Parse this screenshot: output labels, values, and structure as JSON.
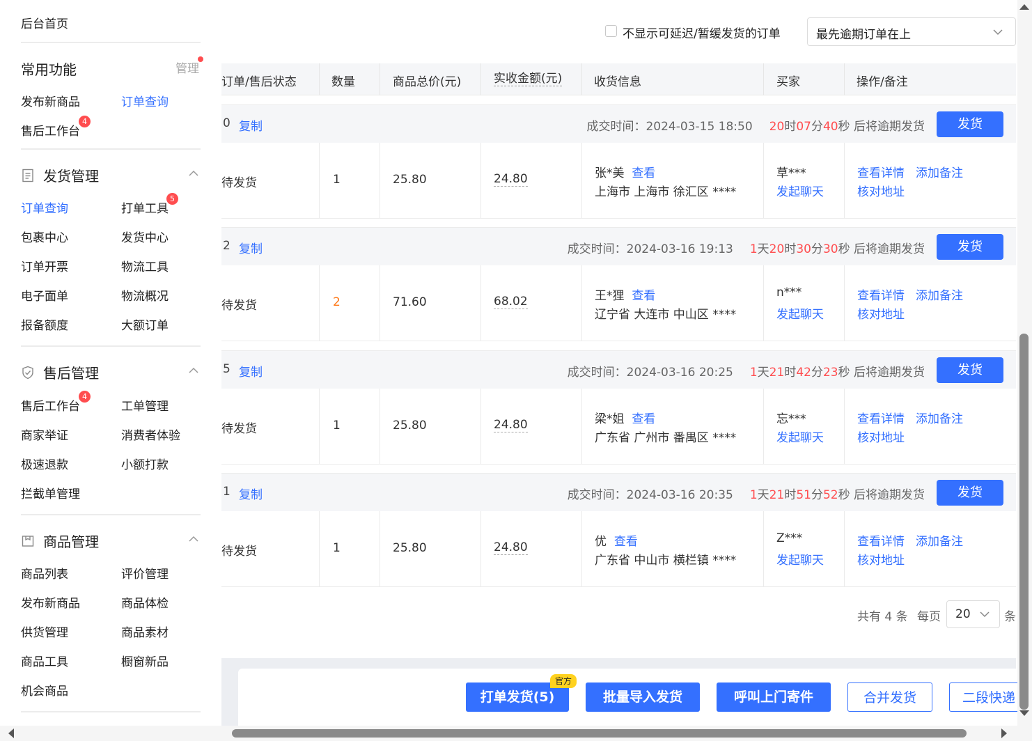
{
  "sidebar": {
    "home": "后台首页",
    "common": {
      "title": "常用功能",
      "manage": "管理",
      "items": [
        {
          "label": "发布新商品"
        },
        {
          "label": "订单查询"
        },
        {
          "label": "售后工作台",
          "badge": "4"
        }
      ]
    },
    "shipping": {
      "title": "发货管理",
      "items": [
        {
          "label": "订单查询"
        },
        {
          "label": "打单工具",
          "badge": "5"
        },
        {
          "label": "包裹中心"
        },
        {
          "label": "发货中心"
        },
        {
          "label": "订单开票"
        },
        {
          "label": "物流工具"
        },
        {
          "label": "电子面单"
        },
        {
          "label": "物流概况"
        },
        {
          "label": "报备额度"
        },
        {
          "label": "大额订单"
        }
      ]
    },
    "aftersale": {
      "title": "售后管理",
      "items": [
        {
          "label": "售后工作台",
          "badge": "4"
        },
        {
          "label": "工单管理"
        },
        {
          "label": "商家举证"
        },
        {
          "label": "消费者体验"
        },
        {
          "label": "极速退款"
        },
        {
          "label": "小额打款"
        },
        {
          "label": "拦截单管理"
        }
      ]
    },
    "goods": {
      "title": "商品管理",
      "items": [
        {
          "label": "商品列表"
        },
        {
          "label": "评价管理"
        },
        {
          "label": "发布新商品"
        },
        {
          "label": "商品体检"
        },
        {
          "label": "供货管理"
        },
        {
          "label": "商品素材"
        },
        {
          "label": "商品工具"
        },
        {
          "label": "橱窗新品"
        },
        {
          "label": "机会商品"
        }
      ]
    }
  },
  "filters": {
    "hide_delayed_label": "不显示可延迟/暂缓发货的订单",
    "sort_value": "最先逾期订单在上"
  },
  "table": {
    "headers": {
      "status": "订单/售后状态",
      "qty": "数量",
      "total": "商品总价(元)",
      "paid": "实收金额(元)",
      "receiver": "收货信息",
      "buyer": "买家",
      "ops": "操作/备注"
    }
  },
  "labels": {
    "copy": "复制",
    "deal_prefix": "成交时间：",
    "overdue_suffix": "后将逾期发货",
    "ship": "发货",
    "view": "查看",
    "chat": "发起聊天",
    "detail": "查看详情",
    "add_note": "添加备注",
    "check_address": "核对地址",
    "u_day": "天",
    "u_hour": "时",
    "u_min": "分",
    "u_sec": "秒"
  },
  "orders": [
    {
      "id_tail": "0",
      "deal_time": "2024-03-15 18:50",
      "cd": {
        "day": "",
        "hour": "20",
        "min": "07",
        "sec": "40"
      },
      "status": "待发货",
      "qty": "1",
      "total": "25.80",
      "paid": "24.80",
      "name": "张*美",
      "address": "上海市 上海市 徐汇区 ****",
      "buyer": "草***"
    },
    {
      "id_tail": "2",
      "deal_time": "2024-03-16 19:13",
      "cd": {
        "day": "1",
        "hour": "20",
        "min": "30",
        "sec": "30"
      },
      "status": "待发货",
      "qty": "2",
      "total": "71.60",
      "paid": "68.02",
      "name": "王*狸",
      "address": "辽宁省 大连市 中山区 ****",
      "buyer": "n***"
    },
    {
      "id_tail": "5",
      "deal_time": "2024-03-16 20:25",
      "cd": {
        "day": "1",
        "hour": "21",
        "min": "42",
        "sec": "23"
      },
      "status": "待发货",
      "qty": "1",
      "total": "25.80",
      "paid": "24.80",
      "name": "梁*姐",
      "address": "广东省 广州市 番禺区 ****",
      "buyer": "忘***"
    },
    {
      "id_tail": "1",
      "deal_time": "2024-03-16 20:35",
      "cd": {
        "day": "1",
        "hour": "21",
        "min": "51",
        "sec": "52"
      },
      "status": "待发货",
      "qty": "1",
      "total": "25.80",
      "paid": "24.80",
      "name": "优",
      "address": "广东省 中山市 横栏镇 ****",
      "buyer": "Z***"
    }
  ],
  "pagination": {
    "total_text": "共有 4 条",
    "per_page_label": "每页",
    "per_page_value": "20",
    "unit": "条"
  },
  "actions": {
    "print_ship": "打单发货(5)",
    "official_tag": "官方",
    "batch_import": "批量导入发货",
    "call_pickup": "呼叫上门寄件",
    "merge_ship": "合并发货",
    "two_stage": "二段快递"
  },
  "colors": {
    "accent": "#3470ff",
    "danger": "#ff4d4f",
    "orange": "#ff7a1a",
    "tag_yellow": "#ffd21f"
  }
}
